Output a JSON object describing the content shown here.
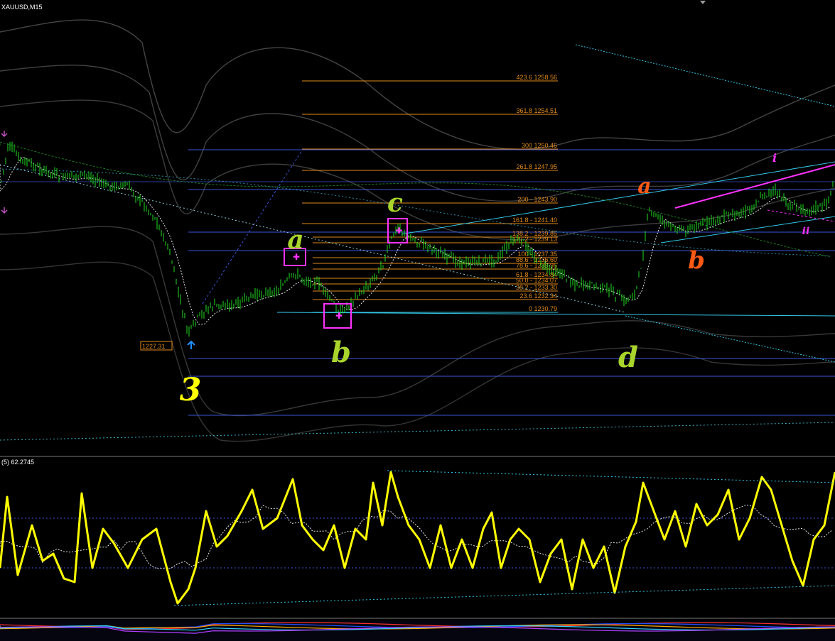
{
  "header": {
    "symbol_label": "XAUUSD,M15",
    "indicator_label": "(5) 62.2745"
  },
  "colors": {
    "background": "#000000",
    "candles": "#22dd22",
    "fibo": "#e08a1a",
    "hline": "#3a56d6",
    "cyan": "#33c6e6",
    "magenta": "#ff33ff",
    "oscillator": "#ffff00",
    "wave_green": "#a9d42c",
    "wave_orange": "#ff5a14",
    "wave_yellow": "#ffff00",
    "white_dash": "#e8e8e8",
    "gray_band": "#5a5a5a"
  },
  "chart_data": [
    {
      "type": "candlestick",
      "symbol": "XAUUSD",
      "timeframe": "M15",
      "price_marker": "1227.31",
      "fibonacci_levels": [
        {
          "ratio": "423.6",
          "price": "1258.56",
          "label": "423.6 1258.56"
        },
        {
          "ratio": "361.8",
          "price": "1254.51",
          "label": "361.8 1254.51"
        },
        {
          "ratio": "300",
          "price": "1250.46",
          "label": "300 1250.46"
        },
        {
          "ratio": "261.8",
          "price": "1247.95",
          "label": "261.8 1247.95"
        },
        {
          "ratio": "200",
          "price": "1243.90",
          "label": "200 - 1243.90"
        },
        {
          "ratio": "161.8",
          "price": "1241.40",
          "label": "161.8 - 1241.40"
        },
        {
          "ratio": "138.2",
          "price": "1239.85",
          "label": "138.2 - 1239.85"
        },
        {
          "ratio": "127.2",
          "price": "1239.13",
          "label": "127.2 - 1239.13"
        },
        {
          "ratio": "100",
          "price": "1237.35",
          "label": "100 - 1237.35"
        },
        {
          "ratio": "88.6",
          "price": "1236.60",
          "label": "88.6 - 1236.60"
        },
        {
          "ratio": "78.6",
          "price": "1235.95",
          "label": "78.6 - 1235.95"
        },
        {
          "ratio": "61.8",
          "price": "1234.84",
          "label": "61.8 - 1234.84"
        },
        {
          "ratio": "50.0",
          "price": "1234.07",
          "label": "50.0 - 1234.07"
        },
        {
          "ratio": "38.2",
          "price": "1233.30",
          "label": "38.2 - 1233.30"
        },
        {
          "ratio": "23.6",
          "price": "1232.34",
          "label": "23.6 1232.34"
        },
        {
          "ratio": "0",
          "price": "1230.79",
          "label": "0 1230.79"
        }
      ],
      "wave_labels": [
        {
          "text": "3",
          "color": "yellow"
        },
        {
          "text": "a",
          "color": "green"
        },
        {
          "text": "b",
          "color": "green"
        },
        {
          "text": "c",
          "color": "green"
        },
        {
          "text": "d",
          "color": "green"
        },
        {
          "text": "a",
          "color": "orange"
        },
        {
          "text": "b",
          "color": "orange"
        },
        {
          "text": "i",
          "color": "magenta"
        },
        {
          "text": "ii",
          "color": "magenta"
        }
      ]
    },
    {
      "type": "line",
      "name": "(5)",
      "last_value": 62.2745
    }
  ]
}
